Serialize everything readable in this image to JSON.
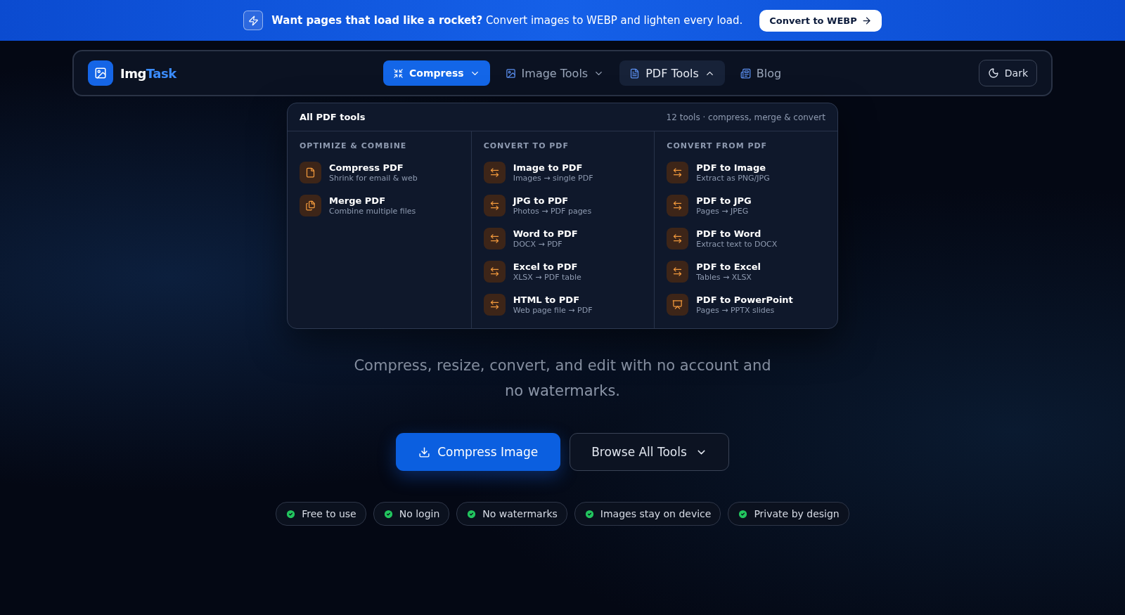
{
  "banner": {
    "lead": "Want pages that load like a rocket?",
    "text": "Convert images to WEBP and lighten every load.",
    "button": "Convert to WEBP"
  },
  "nav": {
    "logo": {
      "first": "Img",
      "second": "Task"
    },
    "items": [
      {
        "label": "Compress",
        "kind": "compress",
        "expanded": false
      },
      {
        "label": "Image Tools",
        "kind": "images",
        "expanded": false
      },
      {
        "label": "PDF Tools",
        "kind": "document",
        "expanded": true
      },
      {
        "label": "Blog",
        "kind": "blog"
      }
    ],
    "theme_button": "Dark"
  },
  "dropdown": {
    "title": "All PDF tools",
    "summary": "12 tools · compress, merge & convert",
    "columns": [
      {
        "heading": "OPTIMIZE & COMBINE",
        "items": [
          {
            "title": "Compress PDF",
            "subtitle": "Shrink for email & web",
            "kind": "document"
          },
          {
            "title": "Merge PDF",
            "subtitle": "Combine multiple files",
            "kind": "pages"
          }
        ]
      },
      {
        "heading": "CONVERT TO PDF",
        "items": [
          {
            "title": "Image to PDF",
            "subtitle": "Images → single PDF",
            "kind": "convert"
          },
          {
            "title": "JPG to PDF",
            "subtitle": "Photos → PDF pages",
            "kind": "convert"
          },
          {
            "title": "Word to PDF",
            "subtitle": "DOCX → PDF",
            "kind": "convert"
          },
          {
            "title": "Excel to PDF",
            "subtitle": "XLSX → PDF table",
            "kind": "convert"
          },
          {
            "title": "HTML to PDF",
            "subtitle": "Web page file → PDF",
            "kind": "convert"
          }
        ]
      },
      {
        "heading": "CONVERT FROM PDF",
        "items": [
          {
            "title": "PDF to Image",
            "subtitle": "Extract as PNG/JPG",
            "kind": "convert"
          },
          {
            "title": "PDF to JPG",
            "subtitle": "Pages → JPEG",
            "kind": "convert"
          },
          {
            "title": "PDF to Word",
            "subtitle": "Extract text to DOCX",
            "kind": "convert"
          },
          {
            "title": "PDF to Excel",
            "subtitle": "Tables → XLSX",
            "kind": "convert"
          },
          {
            "title": "PDF to PowerPoint",
            "subtitle": "Pages → PPTX slides",
            "kind": "slides"
          }
        ]
      }
    ]
  },
  "hero": {
    "subtitle": "Compress, resize, convert, and edit with no account and no watermarks.",
    "primary_button": "Compress Image",
    "secondary_button": "Browse All Tools",
    "features": [
      "Free to use",
      "No login",
      "No watermarks",
      "Images stay on device",
      "Private by design"
    ]
  }
}
